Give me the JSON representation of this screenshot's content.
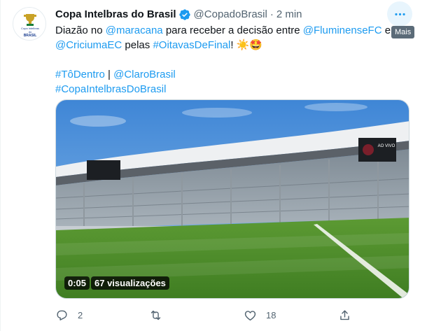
{
  "tweet": {
    "author_name": "Copa Intelbras do Brasil",
    "handle": "@CopadoBrasil",
    "separator": "·",
    "time": "2 min",
    "verified_icon": "verified-badge-icon",
    "more_tooltip": "Mais",
    "avatar_logo": {
      "line1": "Copa Intelbras",
      "line2": "do",
      "line3": "BRASIL"
    },
    "text": {
      "l1_a": "Diazão no ",
      "l1_b": "@maracana",
      "l1_c": " para receber a decisão entre ",
      "l1_d": "@FluminenseFC",
      "l1_e": " e",
      "l2_a": "@CriciumaEC",
      "l2_b": " pelas ",
      "l2_c": "#OitavasDeFinal",
      "l2_d": "! ☀️🤩",
      "l3_a": "#TôDentro",
      "l3_b": " | ",
      "l3_c": "@ClaroBrasil",
      "l4_a": "#CopaIntelbrasDoBrasil"
    },
    "video": {
      "duration": "0:05",
      "views": "67 visualizações",
      "scoreboard_text": "AO VIVO"
    },
    "actions": {
      "reply_count": "2",
      "retweet_count": "",
      "like_count": "18",
      "share_count": ""
    }
  },
  "colors": {
    "link": "#1d9bf0",
    "verified": "#1d9bf0",
    "secondary_text": "#536471",
    "pitch_green": "#4e8a2b",
    "sky_blue": "#4f8fd8"
  }
}
